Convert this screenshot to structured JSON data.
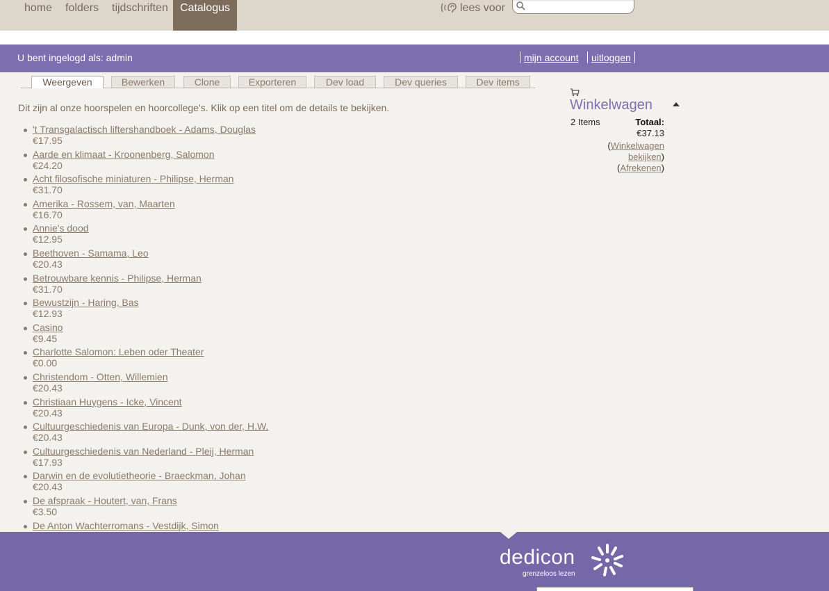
{
  "nav": {
    "items": [
      {
        "label": "home"
      },
      {
        "label": "folders"
      },
      {
        "label": "tijdschriften"
      },
      {
        "label": "Catalogus",
        "active": true
      }
    ],
    "lees_voor": "lees voor",
    "search_placeholder": ""
  },
  "login": {
    "text": "U bent ingelogd als: admin",
    "my_account": "mijn account",
    "logout": "uitloggen"
  },
  "tabs": [
    {
      "label": "Weergeven",
      "active": true
    },
    {
      "label": "Bewerken"
    },
    {
      "label": "Clone"
    },
    {
      "label": "Exporteren"
    },
    {
      "label": "Dev load"
    },
    {
      "label": "Dev queries"
    },
    {
      "label": "Dev items"
    }
  ],
  "intro": "Dit zijn al onze hoorspelen en hoorcollege's. Klik op een titel om de details te bekijken.",
  "catalog": [
    {
      "title": "'t Transgalactisch liftershandboek - Adams, Douglas",
      "price": "€17.95"
    },
    {
      "title": "Aarde en klimaat - Kroonenberg, Salomon",
      "price": "€24.20"
    },
    {
      "title": "Acht filosofische miniaturen - Philipse, Herman",
      "price": "€31.70"
    },
    {
      "title": "Amerika - Rossem, van, Maarten",
      "price": "€16.70"
    },
    {
      "title": "Annie's dood",
      "price": "€12.95"
    },
    {
      "title": "Beethoven - Samama, Leo",
      "price": "€20.43"
    },
    {
      "title": "Betrouwbare kennis - Philipse, Herman",
      "price": "€31.70"
    },
    {
      "title": "Bewustzijn - Haring, Bas",
      "price": "€12.93"
    },
    {
      "title": "Casino",
      "price": "€9.45"
    },
    {
      "title": "Charlotte Salomon: Leben oder Theater",
      "price": "€0.00"
    },
    {
      "title": "Christendom - Otten, Willemien",
      "price": "€20.43"
    },
    {
      "title": "Christiaan Huygens - Icke, Vincent",
      "price": "€20.43"
    },
    {
      "title": "Cultuurgeschiedenis van Europa - Dunk, von der, H.W.",
      "price": "€20.43"
    },
    {
      "title": "Cultuurgeschiedenis van Nederland - Pleij, Herman",
      "price": "€17.93"
    },
    {
      "title": "Darwin en de evolutietheorie - Braeckman, Johan",
      "price": "€20.43"
    },
    {
      "title": "De afspraak - Houtert, van, Frans",
      "price": "€3.50"
    },
    {
      "title": "De Anton Wachterromans - Vestdijk, Simon",
      "price": ""
    }
  ],
  "cart": {
    "title": "Winkelwagen",
    "count": "2 Items",
    "total_label": "Totaal:",
    "total_value": "€37.13",
    "view_link": "Winkelwagen bekijken",
    "checkout_link": "Afrekenen"
  },
  "footer": {
    "logo": "dedicon",
    "tagline": "grenzeloos lezen"
  }
}
